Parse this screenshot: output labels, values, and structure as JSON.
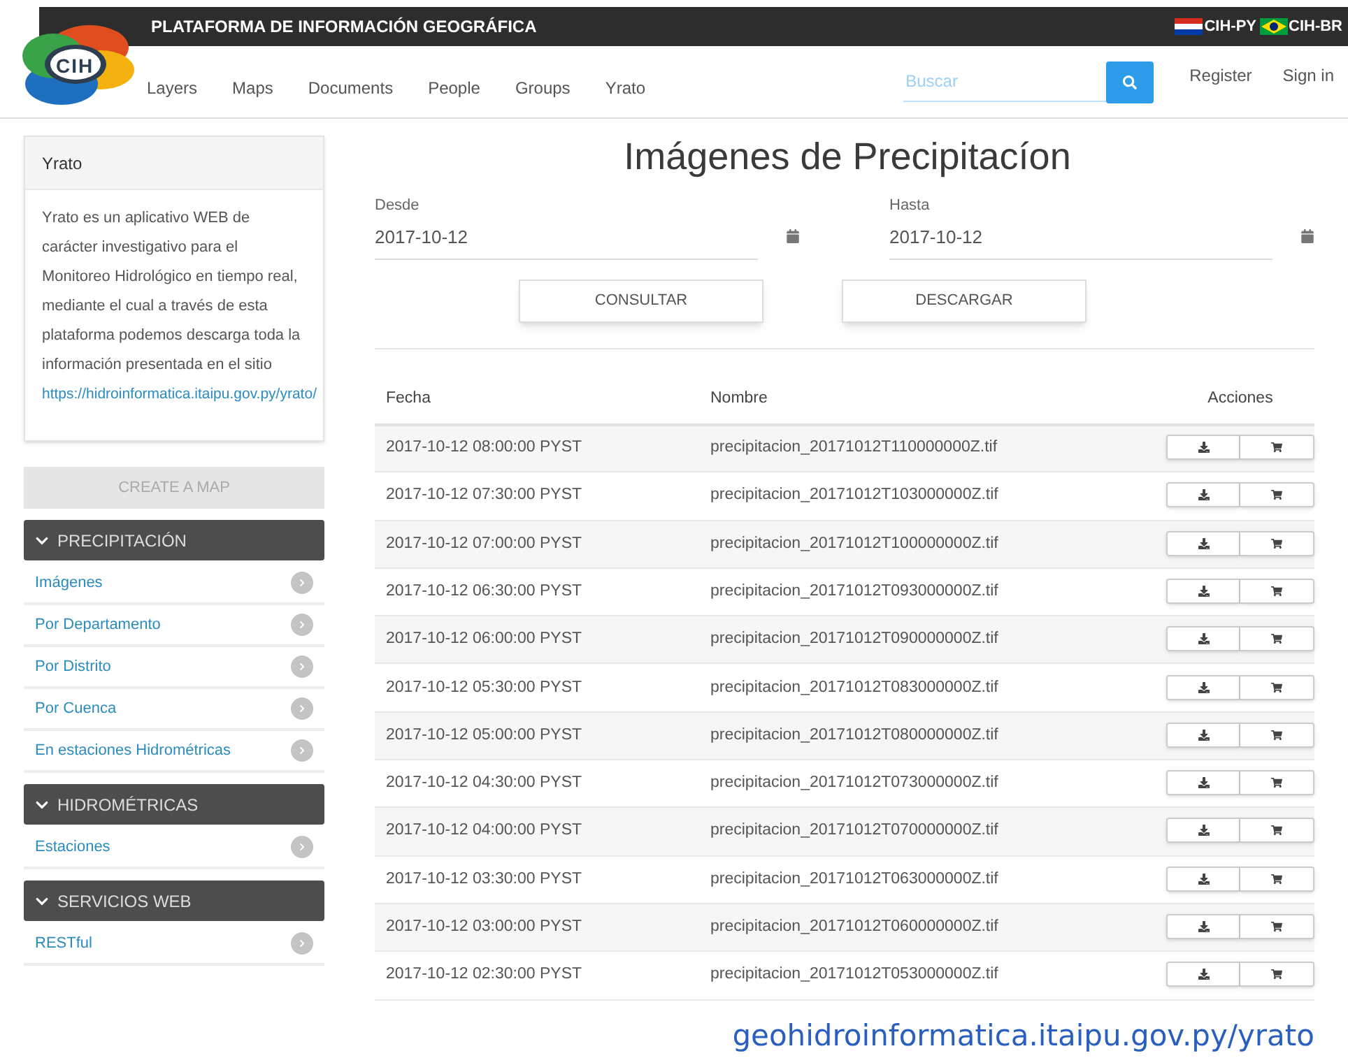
{
  "header": {
    "logo_text": "CIH",
    "title": "PLATAFORMA DE INFORMACIÓN GEOGRÁFICA",
    "languages": [
      {
        "label": "CIH-PY",
        "kind": "py"
      },
      {
        "label": "CIH-BR",
        "kind": "br"
      }
    ]
  },
  "nav": {
    "items": [
      "Layers",
      "Maps",
      "Documents",
      "People",
      "Groups",
      "Yrato"
    ],
    "search": {
      "placeholder": "Buscar"
    },
    "links": [
      "Register",
      "Sign in"
    ]
  },
  "sidebar": {
    "card": {
      "title": "Yrato",
      "text": "Yrato es un aplicativo WEB de carácter investigativo para el Monitoreo Hidrológico en tiempo real, mediante el cual a través de esta plataforma podemos descarga toda la información presentada en el sitio",
      "link": "https://hidroinformatica.itaipu.gov.py/yrato/"
    },
    "create_map": {
      "label": "CREATE A MAP",
      "disabled": true
    },
    "sections": [
      {
        "title": "PRECIPITACIÓN",
        "expanded": true,
        "items": [
          "Imágenes",
          "Por Departamento",
          "Por Distrito",
          "Por Cuenca",
          "En estaciones Hidrométricas"
        ]
      },
      {
        "title": "HIDROMÉTRICAS",
        "expanded": true,
        "items": [
          "Estaciones"
        ]
      },
      {
        "title": "SERVICIOS WEB",
        "expanded": true,
        "items": [
          "RESTful"
        ]
      }
    ]
  },
  "main": {
    "title": "Imágenes de Precipitacíon",
    "fields": [
      {
        "label": "Desde",
        "value": "2017-10-12"
      },
      {
        "label": "Hasta",
        "value": "2017-10-12"
      }
    ],
    "buttons": [
      "CONSULTAR",
      "DESCARGAR"
    ],
    "table": {
      "columns": [
        "Fecha",
        "Nombre",
        "Acciones"
      ],
      "rows": [
        [
          "2017-10-12 08:00:00 PYST",
          "precipitacion_20171012T110000000Z.tif"
        ],
        [
          "2017-10-12 07:30:00 PYST",
          "precipitacion_20171012T103000000Z.tif"
        ],
        [
          "2017-10-12 07:00:00 PYST",
          "precipitacion_20171012T100000000Z.tif"
        ],
        [
          "2017-10-12 06:30:00 PYST",
          "precipitacion_20171012T093000000Z.tif"
        ],
        [
          "2017-10-12 06:00:00 PYST",
          "precipitacion_20171012T090000000Z.tif"
        ],
        [
          "2017-10-12 05:30:00 PYST",
          "precipitacion_20171012T083000000Z.tif"
        ],
        [
          "2017-10-12 05:00:00 PYST",
          "precipitacion_20171012T080000000Z.tif"
        ],
        [
          "2017-10-12 04:30:00 PYST",
          "precipitacion_20171012T073000000Z.tif"
        ],
        [
          "2017-10-12 04:00:00 PYST",
          "precipitacion_20171012T070000000Z.tif"
        ],
        [
          "2017-10-12 03:30:00 PYST",
          "precipitacion_20171012T063000000Z.tif"
        ],
        [
          "2017-10-12 03:00:00 PYST",
          "precipitacion_20171012T060000000Z.tif"
        ],
        [
          "2017-10-12 02:30:00 PYST",
          "precipitacion_20171012T053000000Z.tif"
        ]
      ]
    }
  },
  "caption": "geohidroinformatica.itaipu.gov.py/yrato"
}
